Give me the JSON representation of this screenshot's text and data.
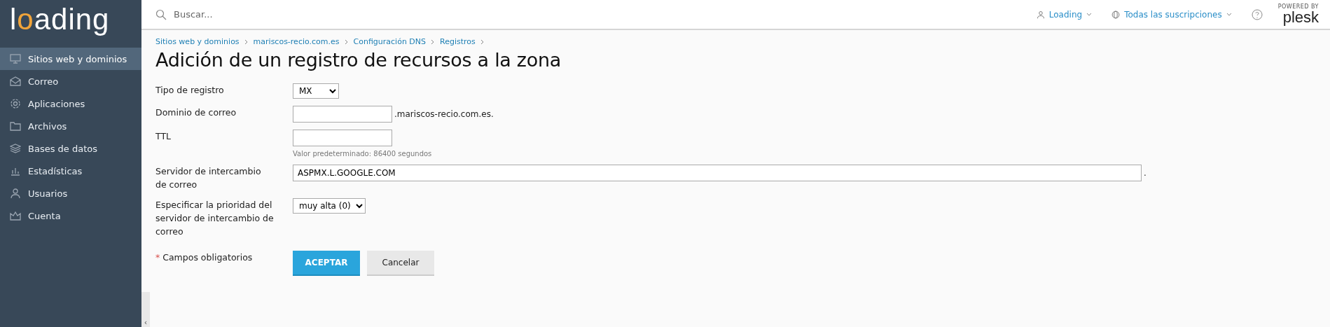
{
  "logo": {
    "parts": [
      {
        "text": "l",
        "accent": false
      },
      {
        "text": "o",
        "accent": true
      },
      {
        "text": "ading",
        "accent": false
      }
    ]
  },
  "sidebar": {
    "items": [
      {
        "label": "Sitios web y dominios",
        "selected": true
      },
      {
        "label": "Correo",
        "selected": false
      },
      {
        "label": "Aplicaciones",
        "selected": false
      },
      {
        "label": "Archivos",
        "selected": false
      },
      {
        "label": "Bases de datos",
        "selected": false
      },
      {
        "label": "Estadísticas",
        "selected": false
      },
      {
        "label": "Usuarios",
        "selected": false
      },
      {
        "label": "Cuenta",
        "selected": false
      }
    ]
  },
  "topbar": {
    "search": {
      "placeholder": "Buscar..."
    },
    "user": "Loading",
    "subscriptions": "Todas las suscripciones",
    "brand_small": "POWERED BY",
    "brand": "plesk"
  },
  "breadcrumbs": [
    "Sitios web y dominios",
    "mariscos-recio.com.es",
    "Configuración DNS",
    "Registros"
  ],
  "title": "Adición de un registro de recursos a la zona",
  "form": {
    "rows": [
      {
        "label": "Tipo de registro",
        "kind": "select",
        "value": "MX"
      },
      {
        "label": "Dominio de correo",
        "kind": "text",
        "value": "",
        "suffix": ".mariscos-recio.com.es."
      },
      {
        "label": "TTL",
        "kind": "text",
        "value": "",
        "hint": "Valor predeterminado: 86400 segundos"
      },
      {
        "label": "Servidor de intercambio de correo",
        "kind": "wide",
        "value": "ASPMX.L.GOOGLE.COM",
        "suffix": "."
      },
      {
        "label": "Especificar la prioridad del servidor de intercambio de correo",
        "kind": "select",
        "value": "muy alta (0)"
      }
    ],
    "required_mark": "*",
    "required_note": "Campos obligatorios",
    "buttons": [
      {
        "label": "ACEPTAR",
        "kind": "primary"
      },
      {
        "label": "Cancelar",
        "kind": "secondary"
      }
    ]
  },
  "collapse_glyph": "‹"
}
